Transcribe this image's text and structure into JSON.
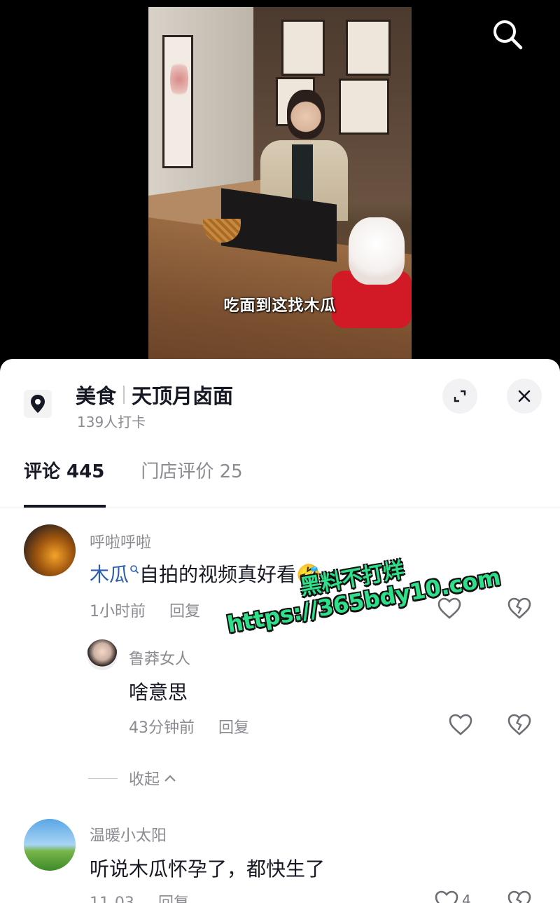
{
  "video": {
    "caption": "吃面到这找木瓜"
  },
  "location": {
    "category": "美食",
    "name": "天顶月卤面",
    "checkins": "139人打卡"
  },
  "tabs": [
    {
      "label": "评论 445"
    },
    {
      "label": "门店评价 25"
    }
  ],
  "comments": [
    {
      "username": "呼啦呼啦",
      "mention": "木瓜",
      "text": "自拍的视频真好看🤣",
      "time": "1小时前",
      "reply_label": "回复"
    },
    {
      "username": "鲁莽女人",
      "text": "啥意思",
      "time": "43分钟前",
      "reply_label": "回复"
    },
    {
      "username": "温暖小太阳",
      "text": "听说木瓜怀孕了，都快生了",
      "time": "11-03",
      "reply_label": "回复",
      "likes": "4"
    }
  ],
  "collapse_label": "收起",
  "watermark": {
    "line1": "黑料不打烊",
    "line2": "https://365bdy10.com"
  },
  "colors": {
    "mention": "#2b5db3",
    "watermark": "#2ee08a",
    "text_primary": "#161823",
    "text_secondary": "#8a8b91"
  },
  "icons": [
    "search-icon",
    "location-pin-icon",
    "expand-icon",
    "close-icon",
    "heart-icon",
    "broken-heart-icon",
    "search-lens-icon",
    "chevron-up-icon"
  ]
}
